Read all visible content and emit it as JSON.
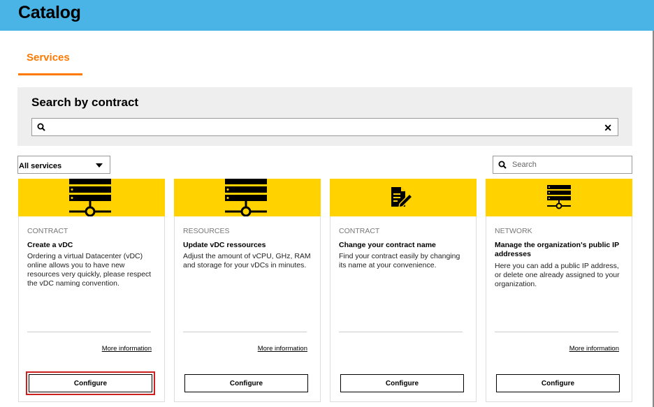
{
  "header": {
    "title": "Catalog",
    "background": "#4bb4e6"
  },
  "tabs": [
    {
      "label": "Services",
      "active": true,
      "color": "#ff7900"
    }
  ],
  "contract_search": {
    "title": "Search by contract",
    "value": "",
    "clear_icon": "close-icon",
    "search_icon": "search-icon"
  },
  "filter": {
    "selected": "All services"
  },
  "search": {
    "placeholder": "Search"
  },
  "cards": [
    {
      "icon": "server-network-icon",
      "category": "CONTRACT",
      "title": "Create a vDC",
      "description": "Ordering a virtual Datacenter (vDC) online allows you to have new resources very quickly, please respect the vDC naming convention.",
      "more": "More information",
      "button": "Configure"
    },
    {
      "icon": "server-network-icon",
      "category": "RESOURCES",
      "title": "Update vDC ressources",
      "description": "Adjust the amount of vCPU, GHz, RAM and storage for your vDCs in minutes.",
      "more": "More information",
      "button": "Configure"
    },
    {
      "icon": "document-edit-icon",
      "category": "CONTRACT",
      "title": "Change your contract name",
      "description": "Find your contract easily by changing its name at your convenience.",
      "button": "Configure"
    },
    {
      "icon": "server-network-icon",
      "category": "NETWORK",
      "title": "Manage the organization's public IP addresses",
      "description": "Here you can add a public IP address, or delete one already assigned to your organization.",
      "more": "More information",
      "button": "Configure"
    }
  ],
  "colors": {
    "card_banner": "#ffd200",
    "highlight": "#cc1f1f"
  }
}
